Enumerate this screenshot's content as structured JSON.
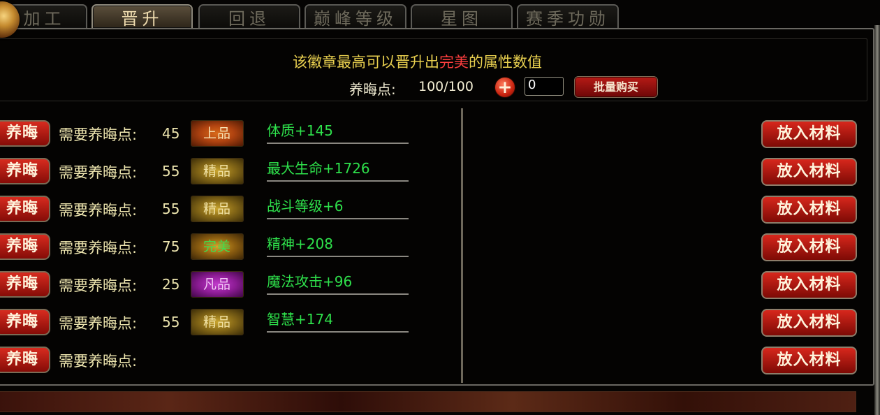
{
  "tabs": [
    {
      "label": "加工"
    },
    {
      "label": "晋升"
    },
    {
      "label": "回退"
    },
    {
      "label": "巅峰等级"
    },
    {
      "label": "星图"
    },
    {
      "label": "赛季功勋"
    }
  ],
  "active_tab": "晋升",
  "header": {
    "title_prefix": "该徽章最高可以晋升出",
    "title_highlight": "完美",
    "title_suffix": "的属性数值",
    "points_label": "养晦点:",
    "points_value": "100/100",
    "plus_label": "+",
    "quantity_value": "0",
    "bulk_buy_label": "批量购买"
  },
  "colors": {
    "title": "#e8cf4f",
    "highlight": "#ff3f3f",
    "attribute_text": "#2ee04b",
    "button_red": "#c8190f"
  },
  "rows": [
    {
      "nurture_label": "养晦",
      "need_label": "需要养晦点:",
      "need_value": "45",
      "grade": "上品",
      "grade_style": "top",
      "attribute": "体质+145",
      "put_label": "放入材料"
    },
    {
      "nurture_label": "养晦",
      "need_label": "需要养晦点:",
      "need_value": "55",
      "grade": "精品",
      "grade_style": "fine",
      "attribute": "最大生命+1726",
      "put_label": "放入材料"
    },
    {
      "nurture_label": "养晦",
      "need_label": "需要养晦点:",
      "need_value": "55",
      "grade": "精品",
      "grade_style": "fine",
      "attribute": "战斗等级+6",
      "put_label": "放入材料"
    },
    {
      "nurture_label": "养晦",
      "need_label": "需要养晦点:",
      "need_value": "75",
      "grade": "完美",
      "grade_style": "perfect",
      "attribute": "精神+208",
      "put_label": "放入材料"
    },
    {
      "nurture_label": "养晦",
      "need_label": "需要养晦点:",
      "need_value": "25",
      "grade": "凡品",
      "grade_style": "common",
      "attribute": "魔法攻击+96",
      "put_label": "放入材料"
    },
    {
      "nurture_label": "养晦",
      "need_label": "需要养晦点:",
      "need_value": "55",
      "grade": "精品",
      "grade_style": "fine",
      "attribute": "智慧+174",
      "put_label": "放入材料"
    },
    {
      "nurture_label": "养晦",
      "need_label": "需要养晦点:",
      "need_value": "",
      "grade": "",
      "grade_style": "",
      "attribute": "",
      "put_label": "放入材料"
    }
  ]
}
